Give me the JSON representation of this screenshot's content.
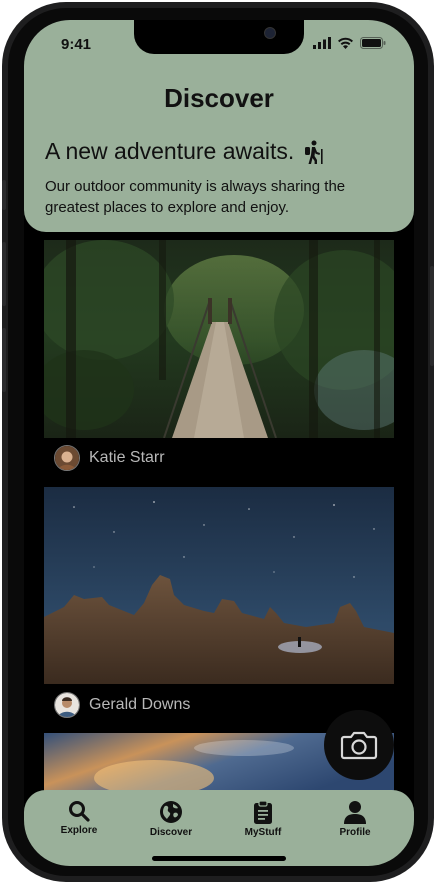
{
  "status_bar": {
    "time": "9:41"
  },
  "header": {
    "title": "Discover",
    "headline": "A new adventure awaits.",
    "subtext": "Our outdoor community is always sharing the greatest places to explore and enjoy."
  },
  "feed": {
    "posts": [
      {
        "author": "Katie Starr"
      },
      {
        "author": "Gerald Downs"
      }
    ]
  },
  "tabbar": {
    "items": [
      {
        "label": "Explore",
        "icon": "search-icon"
      },
      {
        "label": "Discover",
        "icon": "globe-icon"
      },
      {
        "label": "MyStuff",
        "icon": "clipboard-icon"
      },
      {
        "label": "Profile",
        "icon": "user-icon"
      }
    ]
  },
  "colors": {
    "accent": "#9ab09a",
    "background": "#000000",
    "text_dark": "#111111",
    "author_text": "#b8b8b8"
  }
}
